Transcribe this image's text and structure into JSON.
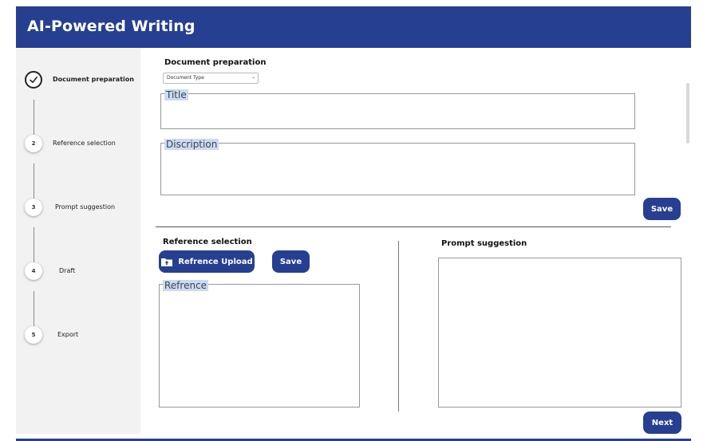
{
  "app": {
    "title": "AI-Powered Writing"
  },
  "sidebar": {
    "steps": [
      {
        "number": "",
        "label": "Document preparation",
        "done": true
      },
      {
        "number": "2",
        "label": "Reference selection"
      },
      {
        "number": "3",
        "label": "Prompt suggestion"
      },
      {
        "number": "4",
        "label": "Draft"
      },
      {
        "number": "5",
        "label": "Export"
      }
    ]
  },
  "document_preparation": {
    "title": "Document preparation",
    "doc_type_select": "Document Type",
    "title_field_label": "Title",
    "description_field_label": "Discription",
    "save_label": "Save"
  },
  "reference_selection": {
    "title": "Reference selection",
    "upload_label": "Refrence Upload",
    "save_label": "Save",
    "reference_field_label": "Refrence"
  },
  "prompt_suggestion": {
    "title": "Prompt suggestion"
  },
  "footer": {
    "next_label": "Next"
  },
  "colors": {
    "brand": "#263f91",
    "sidebar_bg": "#f2f2f2",
    "legend_highlight": "#c9dbf6"
  }
}
